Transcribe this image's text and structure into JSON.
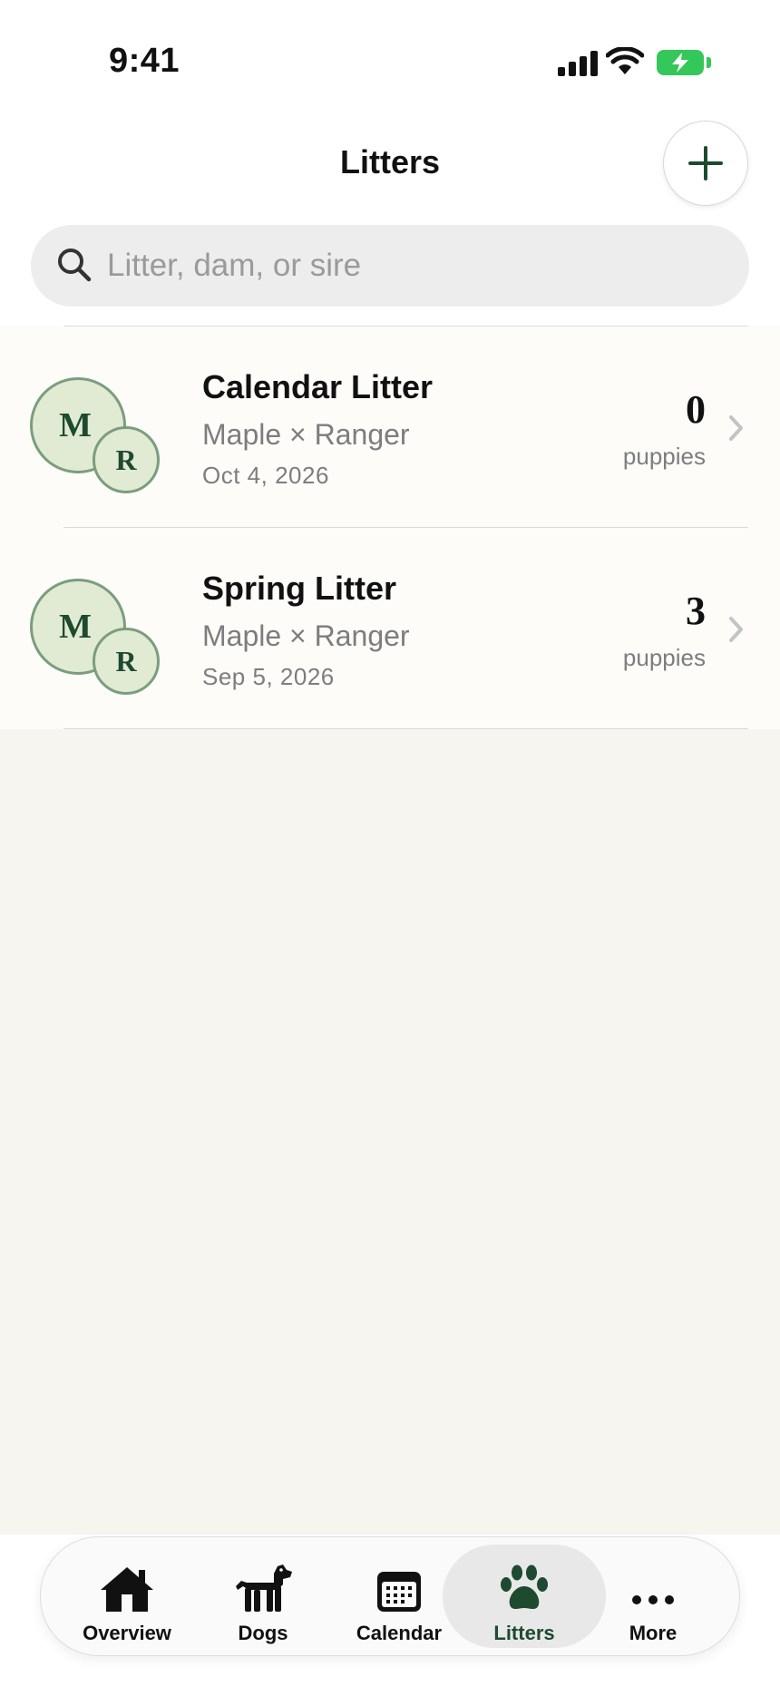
{
  "status_bar": {
    "time": "9:41"
  },
  "header": {
    "title": "Litters"
  },
  "search": {
    "placeholder": "Litter, dam, or sire",
    "value": ""
  },
  "litters": [
    {
      "name": "Calendar Litter",
      "dam_initial": "M",
      "sire_initial": "R",
      "parents": "Maple × Ranger",
      "date": "Oct 4, 2026",
      "puppy_count": "0",
      "count_label": "puppies"
    },
    {
      "name": "Spring Litter",
      "dam_initial": "M",
      "sire_initial": "R",
      "parents": "Maple × Ranger",
      "date": "Sep 5, 2026",
      "puppy_count": "3",
      "count_label": "puppies"
    }
  ],
  "tab_bar": {
    "items": [
      {
        "label": "Overview",
        "icon": "house-icon"
      },
      {
        "label": "Dogs",
        "icon": "dog-icon"
      },
      {
        "label": "Calendar",
        "icon": "calendar-icon"
      },
      {
        "label": "Litters",
        "icon": "paw-icon",
        "active": true
      },
      {
        "label": "More",
        "icon": "ellipsis-icon"
      }
    ]
  },
  "colors": {
    "accent": "#1e4a2f",
    "avatar_fill": "#e1ead3",
    "avatar_border": "#7a9e7c",
    "battery": "#34c759"
  }
}
